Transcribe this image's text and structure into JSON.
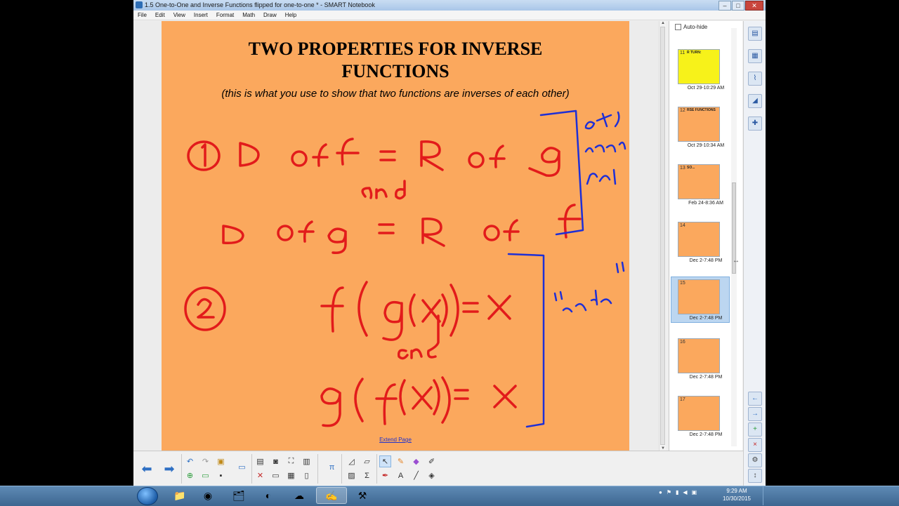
{
  "window": {
    "title": "1.5 One-to-One and Inverse Functions flipped for one-to-one * - SMART Notebook",
    "controls": {
      "minimize": "–",
      "maximize": "□",
      "close": "✕"
    }
  },
  "menu": [
    "File",
    "Edit",
    "View",
    "Insert",
    "Format",
    "Math",
    "Draw",
    "Help"
  ],
  "slide": {
    "title_line1": "TWO PROPERTIES FOR INVERSE",
    "title_line2": "FUNCTIONS",
    "subtitle": "(this is what you use to show that two functions are inverses of each other)",
    "ink_color": "#e21b1b",
    "annotation_color": "#1e2fd6",
    "extend_link": "Extend Page"
  },
  "sorter": {
    "auto_hide_label": "Auto-hide",
    "pages": [
      {
        "number": "11",
        "heading": "R TURN:",
        "label": "Oct 29-10:29 AM",
        "color": "#f7f21a",
        "selected": false
      },
      {
        "number": "12",
        "heading": "RSE FUNCTIONS",
        "label": "Oct 29-10:34 AM",
        "color": "#fba85d",
        "selected": false
      },
      {
        "number": "13",
        "heading": "SO...",
        "label": "Feb 24-8:36 AM",
        "color": "#fba85d",
        "selected": false
      },
      {
        "number": "14",
        "heading": "",
        "label": "Dec 2-7:48 PM",
        "color": "#fba85d",
        "selected": false
      },
      {
        "number": "15",
        "heading": "",
        "label": "Dec 2-7:48 PM",
        "color": "#fba85d",
        "selected": true
      },
      {
        "number": "16",
        "heading": "",
        "label": "Dec 2-7:48 PM",
        "color": "#fba85d",
        "selected": false
      },
      {
        "number": "17",
        "heading": "",
        "label": "Dec 2-7:48 PM",
        "color": "#fba85d",
        "selected": false
      }
    ]
  },
  "taskbar": {
    "time": "9:29 AM",
    "date": "10/30/2015"
  }
}
